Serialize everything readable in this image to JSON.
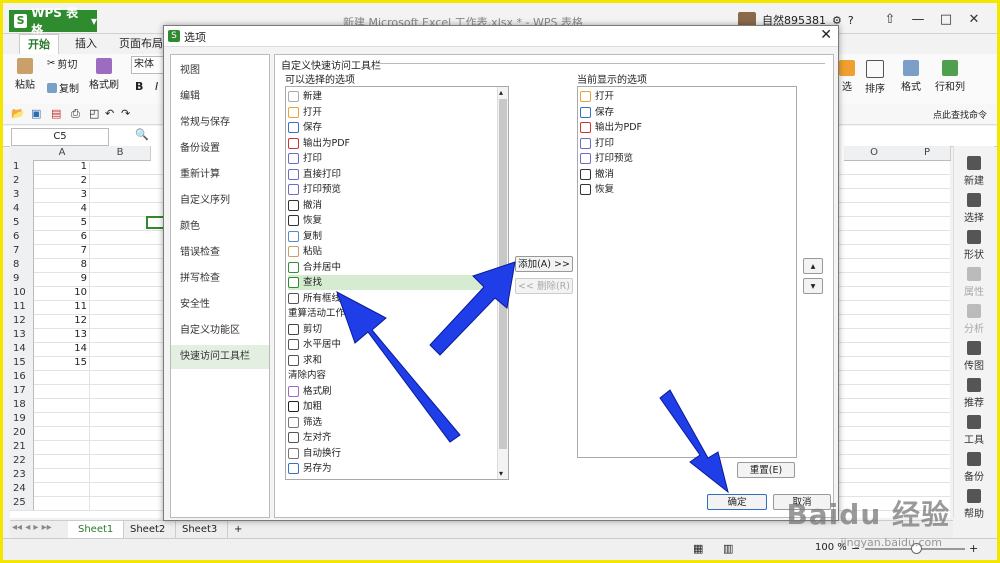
{
  "app": {
    "button_label": "WPS 表格",
    "doc_title": "新建 Microsoft Excel 工作表.xlsx * - WPS 表格",
    "user_name": "自然895381"
  },
  "ribbon": {
    "tabs": [
      "开始",
      "插入",
      "页面布局"
    ],
    "cut": "剪切",
    "paste": "粘贴",
    "copy": "复制",
    "format_painter": "格式刷",
    "font_name": "宋体",
    "bold": "B",
    "italic": "I",
    "right_items": [
      "选",
      "排序",
      "格式",
      "行和列"
    ],
    "search_cmd": "点此查找命令"
  },
  "name_box": "C5",
  "sheet": {
    "col_headers": [
      "A",
      "B",
      "O",
      "P"
    ],
    "rows": [
      "1",
      "2",
      "3",
      "4",
      "5",
      "6",
      "7",
      "8",
      "9",
      "10",
      "11",
      "12",
      "13",
      "14",
      "15",
      "16",
      "17",
      "18",
      "19",
      "20",
      "21",
      "22",
      "23",
      "24",
      "25"
    ],
    "colA_values": [
      "1",
      "2",
      "3",
      "4",
      "5",
      "6",
      "7",
      "8",
      "9",
      "10",
      "11",
      "12",
      "13",
      "14",
      "15"
    ],
    "tabs": [
      "Sheet1",
      "Sheet2",
      "Sheet3"
    ],
    "add_tab": "+"
  },
  "right_sidebar": [
    "新建",
    "选择",
    "形状",
    "属性",
    "分析",
    "传图",
    "推荐",
    "工具",
    "备份",
    "帮助"
  ],
  "status": {
    "zoom": "100 %"
  },
  "dialog": {
    "title": "选项",
    "nav": [
      "视图",
      "编辑",
      "常规与保存",
      "备份设置",
      "重新计算",
      "自定义序列",
      "颜色",
      "错误检查",
      "拼写检查",
      "安全性",
      "自定义功能区",
      "快速访问工具栏"
    ],
    "active_nav": "快速访问工具栏",
    "section_title": "自定义快速访问工具栏",
    "available_label": "可以选择的选项",
    "current_label": "当前显示的选项",
    "available": [
      {
        "label": "新建",
        "icon": "new-icon"
      },
      {
        "label": "打开",
        "icon": "open-icon"
      },
      {
        "label": "保存",
        "icon": "save-icon"
      },
      {
        "label": "输出为PDF",
        "icon": "pdf-icon"
      },
      {
        "label": "打印",
        "icon": "print-icon"
      },
      {
        "label": "直接打印",
        "icon": "direct-print-icon"
      },
      {
        "label": "打印预览",
        "icon": "print-preview-icon"
      },
      {
        "label": "撤消",
        "icon": "undo-icon"
      },
      {
        "label": "恢复",
        "icon": "redo-icon"
      },
      {
        "label": "复制",
        "icon": "copy-icon"
      },
      {
        "label": "粘贴",
        "icon": "paste-icon"
      },
      {
        "label": "合并居中",
        "icon": "merge-center-icon"
      },
      {
        "label": "查找",
        "icon": "find-icon"
      },
      {
        "label": "所有框线",
        "icon": "borders-icon"
      },
      {
        "label": "重算活动工作表",
        "icon": ""
      },
      {
        "label": "剪切",
        "icon": "cut-icon"
      },
      {
        "label": "水平居中",
        "icon": "align-center-icon"
      },
      {
        "label": "求和",
        "icon": "sum-icon"
      },
      {
        "label": "清除内容",
        "icon": ""
      },
      {
        "label": "格式刷",
        "icon": "format-painter-icon"
      },
      {
        "label": "加粗",
        "icon": "bold-icon"
      },
      {
        "label": "筛选",
        "icon": "filter-icon"
      },
      {
        "label": "左对齐",
        "icon": "align-left-icon"
      },
      {
        "label": "自动换行",
        "icon": "wrap-text-icon"
      },
      {
        "label": "另存为",
        "icon": "save-as-icon"
      }
    ],
    "selected_available": "查找",
    "current": [
      {
        "label": "打开",
        "icon": "open-icon"
      },
      {
        "label": "保存",
        "icon": "save-icon"
      },
      {
        "label": "输出为PDF",
        "icon": "pdf-icon"
      },
      {
        "label": "打印",
        "icon": "print-icon"
      },
      {
        "label": "打印预览",
        "icon": "print-preview-icon"
      },
      {
        "label": "撤消",
        "icon": "undo-icon"
      },
      {
        "label": "恢复",
        "icon": "redo-icon"
      }
    ],
    "add_button": "添加(A) >>",
    "remove_button": "<< 删除(R)",
    "reset_button": "重置(E)",
    "ok_button": "确定",
    "cancel_button": "取消"
  },
  "watermark": {
    "main": "Baidu 经验",
    "sub": "jingyan.baidu.com"
  },
  "colors": {
    "accent_green": "#2e8b2e",
    "arrow_blue": "#1f3ee8",
    "frame_yellow": "#f5e600",
    "selection_green": "#d5ecd0"
  }
}
